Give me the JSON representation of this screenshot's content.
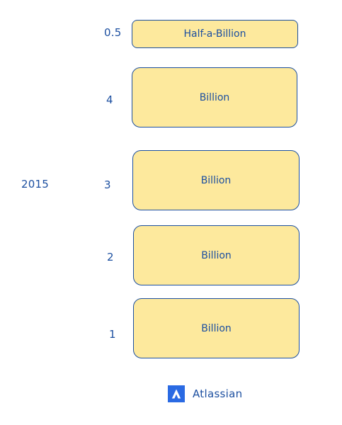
{
  "year_label": "2015",
  "levels": [
    {
      "number": "0.5",
      "text": "Half-a-Billion"
    },
    {
      "number": "4",
      "text": "Billion"
    },
    {
      "number": "3",
      "text": "Billion"
    },
    {
      "number": "2",
      "text": "Billion"
    },
    {
      "number": "1",
      "text": "Billion"
    }
  ],
  "brand": {
    "name": "Atlassian",
    "logo_icon": "atlassian-logo-icon",
    "logo_color": "#2a6ae3"
  },
  "colors": {
    "block_fill": "#fde99d",
    "stroke": "#1c4fa0"
  }
}
